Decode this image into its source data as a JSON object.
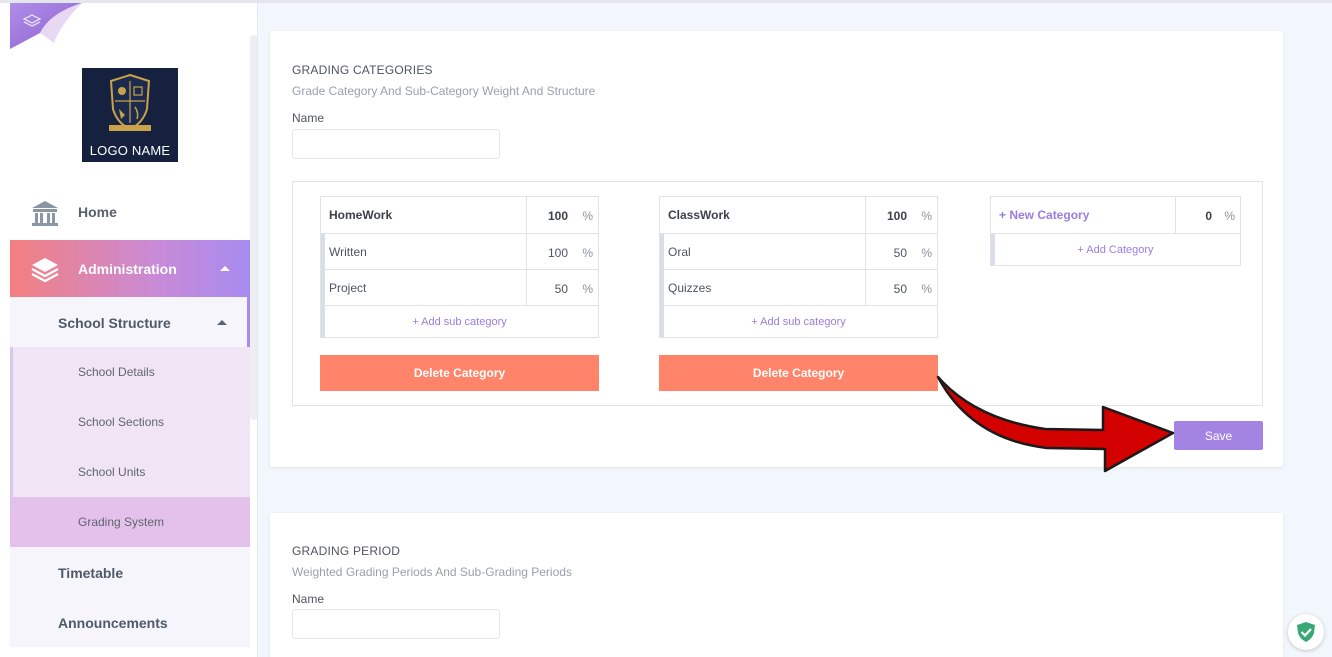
{
  "sidebar": {
    "logo_text": "LOGO NAME",
    "items": {
      "home": "Home",
      "administration": "Administration",
      "school_structure": "School Structure",
      "school_details": "School Details",
      "school_sections": "School Sections",
      "school_units": "School Units",
      "grading_system": "Grading System",
      "timetable": "Timetable",
      "announcements": "Announcements"
    }
  },
  "grading_categories": {
    "title": "GRADING CATEGORIES",
    "subtitle": "Grade Category And Sub-Category Weight And Structure",
    "name_label": "Name",
    "name_value": "",
    "categories": [
      {
        "name": "HomeWork",
        "weight": "100",
        "unit": "%",
        "subs": [
          {
            "name": "Written",
            "weight": "100",
            "unit": "%"
          },
          {
            "name": "Project",
            "weight": "50",
            "unit": "%"
          }
        ],
        "add_sub_label": "+ Add sub category",
        "delete_label": "Delete Category"
      },
      {
        "name": "ClassWork",
        "weight": "100",
        "unit": "%",
        "subs": [
          {
            "name": "Oral",
            "weight": "50",
            "unit": "%"
          },
          {
            "name": "Quizzes",
            "weight": "50",
            "unit": "%"
          }
        ],
        "add_sub_label": "+ Add sub category",
        "delete_label": "Delete Category"
      }
    ],
    "new_category": {
      "name": "+ New Category",
      "weight": "0",
      "unit": "%",
      "add_label": "+ Add Category"
    },
    "save_label": "Save"
  },
  "grading_period": {
    "title": "GRADING PERIOD",
    "subtitle": "Weighted Grading Periods And Sub-Grading Periods",
    "name_label": "Name",
    "name_value": ""
  },
  "colors": {
    "accent_purple": "#a484e2",
    "delete_orange": "#ff8469",
    "annotation_arrow": "#d30000"
  }
}
